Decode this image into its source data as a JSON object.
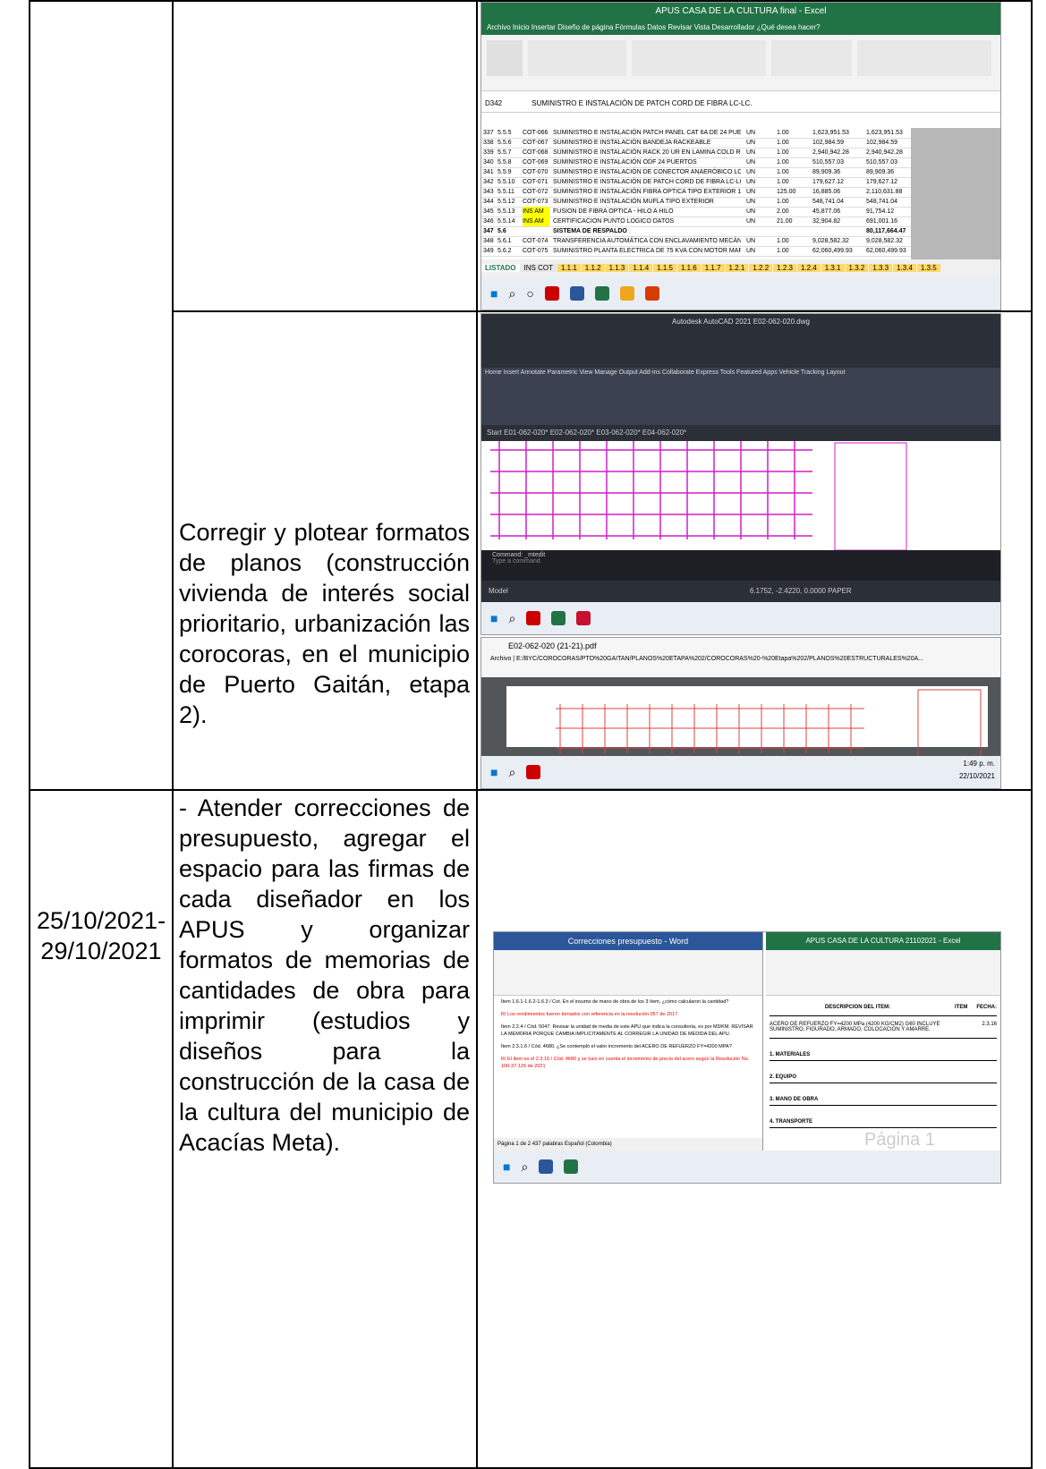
{
  "row2": {
    "description": [
      "Corregir",
      "y",
      "plotear",
      "formatos",
      "de",
      "planos",
      "(construcción vivienda de interés social prioritario, urbanización las corocoras, en el municipio de Puerto Gaitán, etapa 2)."
    ],
    "description_text": "Corregir y plotear formatos de planos (construcción vivienda de interés social prioritario, urbanización las corocoras, en el municipio de Puerto Gaitán, etapa 2)."
  },
  "row3": {
    "date": "25/10/2021-29/10/2021",
    "date_a": "25/10/2021-",
    "date_b": "29/10/2021",
    "description": "- Atender correcciones de presupuesto, agregar el espacio para las firmas de cada diseñador en los APUS y organizar formatos de memorias de cantidades de obra para imprimir (estudios y diseños para la construcción de la casa de la cultura del municipio de Acacías Meta)."
  },
  "excel": {
    "title": "APUS CASA DE LA CULTURA final - Excel",
    "tabs": "Archivo   Inicio   Insertar   Diseño de página   Fórmulas   Datos   Revisar   Vista   Desarrollador   ¿Qué desea hacer?",
    "cell_ref": "D342",
    "formula": "SUMINISTRO E INSTALACIÓN DE PATCH CORD DE FIBRA LC-LC.",
    "rows": [
      {
        "n": "337",
        "item": "5.5.5",
        "code": "COT-066",
        "desc": "SUMINISTRO E INSTALACIÓN PATCH PANEL CAT 6A DE 24 PUERTOS",
        "un": "UN",
        "qty": "1.00",
        "unit": "1,623,951.53",
        "total": "1,623,951.53"
      },
      {
        "n": "338",
        "item": "5.5.6",
        "code": "COT-067",
        "desc": "SUMINISTRO E INSTALACIÓN BANDEJA RACKEABLE",
        "un": "UN",
        "qty": "1.00",
        "unit": "102,984.59",
        "total": "102,984.59"
      },
      {
        "n": "339",
        "item": "5.5.7",
        "code": "COT-068",
        "desc": "SUMINISTRO E INSTALACIÓN RACK 20 UR EN LAMINA COLD ROLLED, CON PINTURA",
        "un": "UN",
        "qty": "1.00",
        "unit": "2,940,942.28",
        "total": "2,940,942.28"
      },
      {
        "n": "340",
        "item": "5.5.8",
        "code": "COT-069",
        "desc": "SUMINISTRO E INSTALACIÓN ODF 24 PUERTOS",
        "un": "UN",
        "qty": "1.00",
        "unit": "510,557.03",
        "total": "510,557.03"
      },
      {
        "n": "341",
        "item": "5.5.9",
        "code": "COT-070",
        "desc": "SUMINISTRO E INSTALACIÓN DE CONECTOR ANAERÓBICO LC MULTIMODO",
        "un": "UN",
        "qty": "1.00",
        "unit": "89,909.36",
        "total": "89,909.36"
      },
      {
        "n": "342",
        "item": "5.5.10",
        "code": "COT-071",
        "desc": "SUMINISTRO E INSTALACIÓN DE PATCH CORD DE FIBRA LC-LC",
        "un": "UN",
        "qty": "1.00",
        "unit": "179,627.12",
        "total": "179,627.12"
      },
      {
        "n": "343",
        "item": "5.5.11",
        "code": "COT-072",
        "desc": "SUMINISTRO E INSTALACIÓN FIBRA OPTICA TIPO EXTERIOR 12 HILOS",
        "un": "UN",
        "qty": "125.00",
        "unit": "16,885.06",
        "total": "2,110,631.88"
      },
      {
        "n": "344",
        "item": "5.5.12",
        "code": "COT-073",
        "desc": "SUMINISTRO E INSTALACIÓN MUFLA TIPO EXTERIOR",
        "un": "UN",
        "qty": "1.00",
        "unit": "548,741.04",
        "total": "548,741.04"
      },
      {
        "n": "345",
        "item": "5.5.13",
        "code": "INS AM",
        "desc": "FUSION DE FIBRA OPTICA - HILO A HILO",
        "un": "UN",
        "qty": "2.00",
        "unit": "45,877.06",
        "total": "91,754.12"
      },
      {
        "n": "346",
        "item": "5.5.14",
        "code": "INS AM",
        "desc": "CERTIFICACION PUNTO LOGICO DATOS",
        "un": "UN",
        "qty": "21.00",
        "unit": "32,904.82",
        "total": "691,001.16"
      },
      {
        "n": "347",
        "item": "5.6",
        "code": "",
        "desc": "SISTEMA DE RESPALDO",
        "un": "",
        "qty": "",
        "unit": "",
        "total": "80,117,664.47"
      },
      {
        "n": "348",
        "item": "5.6.1",
        "code": "COT-074",
        "desc": "TRANSFERENCIA AUTOMÁTICA CON ENCLAVAMIENTO MECÁNICO SISTEMA DE INCENDIOS",
        "un": "UN",
        "qty": "1.00",
        "unit": "9,028,582.32",
        "total": "9,028,582.32"
      },
      {
        "n": "349",
        "item": "5.6.2",
        "code": "COT-075",
        "desc": "SUMINISTRO PLANTA ELECTRICA DE 75 KVA CON MOTOR MARCA CUMMINS",
        "un": "UN",
        "qty": "1.00",
        "unit": "62,060,499.93",
        "total": "62,060,499.93"
      }
    ],
    "sheet_tabs": [
      "LISTADO",
      "INS COT",
      "1.1.1",
      "1.1.2",
      "1.1.3",
      "1.1.4",
      "1.1.5",
      "1.1.6",
      "1.1.7",
      "1.2.1",
      "1.2.2",
      "1.2.3",
      "1.2.4",
      "1.3.1",
      "1.3.2",
      "1.3.3",
      "1.3.4",
      "1.3.5"
    ]
  },
  "cad": {
    "title": "Autodesk AutoCAD 2021  E02-062-020.dwg",
    "tabs": "Home  Insert  Annotate  Parametric  View  Manage  Output  Add-ins  Collaborate  Express Tools  Featured Apps  Vehicle Tracking  Layout",
    "doc_tabs": "Start    E01-062-020*    E02-062-020*    E03-062-020*    E04-062-020*",
    "cmd": "Command: _mtedit",
    "cmd_prompt": "Type a command",
    "coords": "6.1752, -2.4220, 0.0000  PAPER",
    "model": "Model"
  },
  "pdf": {
    "tab": "E02-062-020 (21-21).pdf",
    "url": "Archivo  |  E:/BYC/COROCORAS/PTO%20GAITAN/PLANOS%20ETAPA%202/COROCORAS%20-%20Etapa%202/PLANOS%20ESTRUCTURALES%20A...",
    "time": "1:49 p. m.",
    "date": "22/10/2021"
  },
  "word": {
    "title": "Correcciones presupuesto - Word",
    "lines": [
      "Ítem 1.6.1-1.6.2-1.6.3 / Cot. En el insumo de mano de obra de los 3 ítem, ¿cómo calcularon la cantidad?",
      "R/ Los rendimientos fueron tomados con referencia en la resolución 057 de 2017.",
      "Ítem 2.2.4 / Cód. 5047. Revisar la unidad de media de este APU que indica la consultoría, es por M3/KM. REVISAR LA MEMORIA PORQUE CAMBIA IMPLICITAMENTE AL CORREGIR LA UNIDAD DE MEDIDA DEL APU.",
      "Ítem 2.3.1.6 / Cód. 4680. ¿Se contempló el valor incremento del ACERO DE REFUERZO FY=4200 MPA?",
      "R/ El ítem es el 2.3.16 / Cód. 4680 y se tuvo en cuenta el incremento de precio del acero según la Resolución No. 100-37-126 de 2021"
    ],
    "status": "Página 1 de 2   437 palabras   Español (Colombia)"
  },
  "excel2": {
    "title": "APUS CASA DE LA CULTURA 21102021 - Excel",
    "header": "DESCRIPCION DEL ITEM:",
    "item_col": "ITEM",
    "fecha": "FECHA:",
    "desc": "ACERO DE REFUERZO FY=4200 MPa (4200 KG/CM2) G60 INCLUYE SUMINISTRO, FIGURADO, ARMADO, COLOCACIÓN Y AMARRE.",
    "item": "2.3.16",
    "sections": [
      "1. MATERIALES",
      "2. EQUIPO",
      "3. MANO DE OBRA",
      "4. TRANSPORTE"
    ],
    "watermark": "Página 1"
  }
}
